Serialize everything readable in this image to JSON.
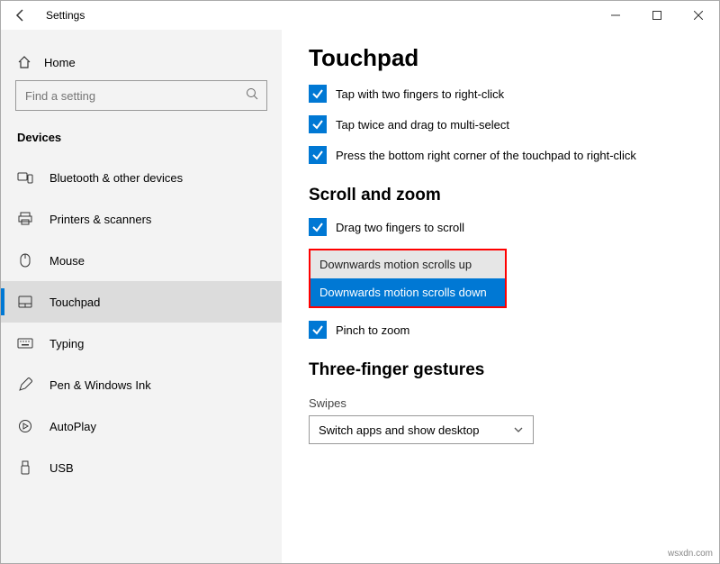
{
  "titlebar": {
    "title": "Settings"
  },
  "sidebar": {
    "home": "Home",
    "search_placeholder": "Find a setting",
    "section": "Devices",
    "items": [
      {
        "label": "Bluetooth & other devices"
      },
      {
        "label": "Printers & scanners"
      },
      {
        "label": "Mouse"
      },
      {
        "label": "Touchpad"
      },
      {
        "label": "Typing"
      },
      {
        "label": "Pen & Windows Ink"
      },
      {
        "label": "AutoPlay"
      },
      {
        "label": "USB"
      }
    ]
  },
  "content": {
    "title": "Touchpad",
    "check1": "Tap with two fingers to right-click",
    "check2": "Tap twice and drag to multi-select",
    "check3": "Press the bottom right corner of the touchpad to right-click",
    "scroll_heading": "Scroll and zoom",
    "check4": "Drag two fingers to scroll",
    "dd_option_normal": "Downwards motion scrolls up",
    "dd_option_highlight": "Downwards motion scrolls down",
    "check5": "Pinch to zoom",
    "three_finger_heading": "Three-finger gestures",
    "swipes_label": "Swipes",
    "swipes_value": "Switch apps and show desktop"
  },
  "watermark": "wsxdn.com"
}
